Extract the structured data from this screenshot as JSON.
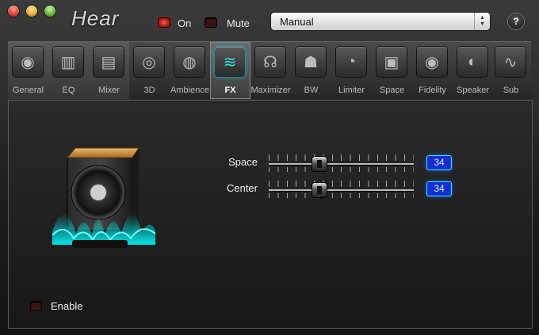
{
  "titlebar": {
    "app_name": "Hear",
    "on_label": "On",
    "mute_label": "Mute",
    "preset_value": "Manual",
    "help_label": "?"
  },
  "tabs": [
    {
      "label": "General",
      "icon": "general-icon"
    },
    {
      "label": "EQ",
      "icon": "eq-icon"
    },
    {
      "label": "Mixer",
      "icon": "mixer-icon"
    },
    {
      "label": "3D",
      "icon": "3d-icon"
    },
    {
      "label": "Ambience",
      "icon": "ambience-icon"
    },
    {
      "label": "FX",
      "icon": "fx-icon",
      "active": true
    },
    {
      "label": "Maximizer",
      "icon": "maximizer-icon"
    },
    {
      "label": "BW",
      "icon": "bw-icon"
    },
    {
      "label": "Limiter",
      "icon": "limiter-icon"
    },
    {
      "label": "Space",
      "icon": "space-icon"
    },
    {
      "label": "Fidelity",
      "icon": "fidelity-icon"
    },
    {
      "label": "Speaker",
      "icon": "speaker-icon"
    },
    {
      "label": "Sub",
      "icon": "sub-icon"
    }
  ],
  "fx": {
    "sliders": [
      {
        "label": "Space",
        "value": "34"
      },
      {
        "label": "Center",
        "value": "34"
      }
    ],
    "enable_label": "Enable"
  },
  "colors": {
    "accent": "#2ee6e6",
    "readout_bg": "#1a2bd0",
    "led_on": "#e33322"
  }
}
